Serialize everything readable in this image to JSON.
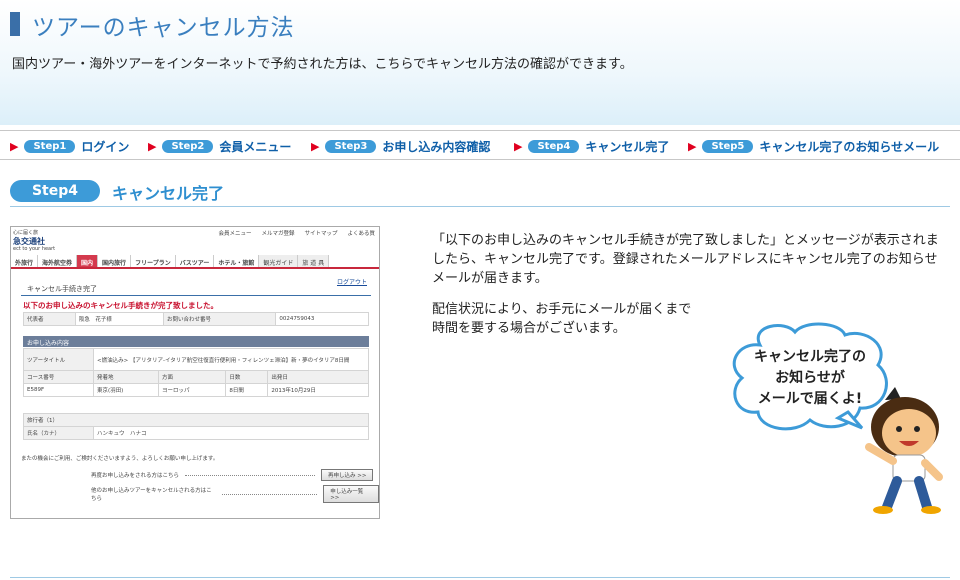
{
  "header": {
    "title": "ツアーのキャンセル方法",
    "intro": "国内ツアー・海外ツアーをインターネットで予約された方は、こちらでキャンセル方法の確認ができます。"
  },
  "steps": [
    {
      "pill": "Step1",
      "label": "ログイン"
    },
    {
      "pill": "Step2",
      "label": "会員メニュー"
    },
    {
      "pill": "Step3",
      "label": "お申し込み内容確認"
    },
    {
      "pill": "Step4",
      "label": "キャンセル完了"
    },
    {
      "pill": "Step5",
      "label": "キャンセル完了のお知らせメール"
    }
  ],
  "section": {
    "pill": "Step4",
    "label": "キャンセル完了"
  },
  "screenshot": {
    "logo_top": "心に届く旅",
    "logo_name": "急交通社",
    "logo_sub": "ect to your heart",
    "toplinks": [
      "会員メニュー",
      "メルマガ登録",
      "サイトマップ",
      "よくある質"
    ],
    "nav": [
      "外旅行",
      "海外航空券",
      "国内",
      "国内旅行",
      "フリープラン",
      "バスツアー",
      "ホテル・旅館",
      "観光ガイド",
      "旅 道 具"
    ],
    "logout": "ログアウト",
    "box_title": "キャンセル手続き完了",
    "alert": "以下のお申し込みのキャンセル手続きが完了致しました。",
    "row1": [
      "代表者",
      "阪急　花子様",
      "お問い合わせ番号",
      "0024759043"
    ],
    "subhead1": "お申し込み内容",
    "tour_label": "ツアータイトル",
    "tour_value": "<燃油込み> 【アリタリア-イタリア航空往復直行便利用・フィレンツェ滞泊】新・夢のイタリア8日間",
    "cols": [
      "コース番号",
      "発着地",
      "方面",
      "日数",
      "出発日"
    ],
    "vals": [
      "E589F",
      "東京(羽田)",
      "ヨーロッパ",
      "8日間",
      "2013年10月29日"
    ],
    "subhead2": "旅行者（1）",
    "name_label": "氏名（カナ）",
    "name_value": "ハンキュウ　ハナコ",
    "footer": "またの機会にご利用、ご検討くださいますよう、よろしくお願い申し上げます。",
    "link1": "再度お申し込みをされる方はこちら",
    "btn1": "再申し込み >>",
    "link2": "他のお申し込みツアーをキャンセルされる方はこちら",
    "btn2": "申し込み一覧 >>"
  },
  "description": {
    "p1": "「以下のお申し込みのキャンセル手続きが完了致しました」とメッセージが表示されましたら、キャンセル完了です。登録されたメールアドレスにキャンセル完了のお知らせメールが届きます。",
    "p2_line1": "配信状況により、お手元にメールが届くまで",
    "p2_line2": "時間を要する場合がございます。"
  },
  "bubble": {
    "line1": "キャンセル完了の",
    "line2": "お知らせが",
    "line3": "メールで届くよ!"
  },
  "colors": {
    "accent": "#3d9bd8",
    "title": "#3a7fbf",
    "alert": "#c8102e",
    "arrow": "#e0001f"
  }
}
